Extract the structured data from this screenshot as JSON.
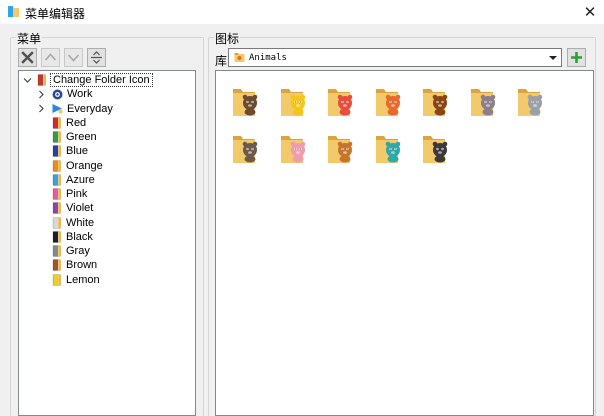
{
  "window": {
    "title": "菜单编辑器",
    "close_glyph": "✕"
  },
  "menu_group": {
    "label": "菜单",
    "toolbar": {
      "delete_icon": "delete-x-icon",
      "move_up_icon": "arrow-up-icon",
      "move_down_icon": "arrow-down-icon",
      "separator_icon": "separator-icon"
    }
  },
  "tree": {
    "root": {
      "label": "Change Folder Icon",
      "color": "#c0392b",
      "expanded": true
    },
    "items": [
      {
        "label": "Work",
        "icon": "work-icon",
        "color": "#2b4a9a",
        "has_children": true
      },
      {
        "label": "Everyday",
        "icon": "everyday-icon",
        "color": "#2e86de",
        "has_children": true
      },
      {
        "label": "Red",
        "icon": "flag-icon",
        "color": "#d62828",
        "has_children": false
      },
      {
        "label": "Green",
        "icon": "flag-icon",
        "color": "#2e9e4a",
        "has_children": false
      },
      {
        "label": "Blue",
        "icon": "flag-icon",
        "color": "#2a3ea8",
        "has_children": false
      },
      {
        "label": "Orange",
        "icon": "flag-icon",
        "color": "#f08a1c",
        "has_children": false
      },
      {
        "label": "Azure",
        "icon": "flag-icon",
        "color": "#2fa4e7",
        "has_children": false
      },
      {
        "label": "Pink",
        "icon": "flag-icon",
        "color": "#e85aa3",
        "has_children": false
      },
      {
        "label": "Violet",
        "icon": "flag-icon",
        "color": "#8e44ad",
        "has_children": false
      },
      {
        "label": "White",
        "icon": "flag-icon",
        "color": "#d8d8d8",
        "has_children": false
      },
      {
        "label": "Black",
        "icon": "flag-icon",
        "color": "#1e1e2e",
        "has_children": false
      },
      {
        "label": "Gray",
        "icon": "flag-icon",
        "color": "#7f8c8d",
        "has_children": false
      },
      {
        "label": "Brown",
        "icon": "flag-icon",
        "color": "#a0522d",
        "has_children": false
      },
      {
        "label": "Lemon",
        "icon": "flag-icon",
        "color": "#e6d21a",
        "has_children": false
      }
    ]
  },
  "icon_group": {
    "label": "图标",
    "library_label": "库",
    "library_value": "Animals",
    "add_icon": "plus-icon",
    "icons": [
      {
        "name": "cat",
        "color": "#6b4a2f"
      },
      {
        "name": "chick",
        "color": "#f5c518"
      },
      {
        "name": "crab",
        "color": "#e74c3c"
      },
      {
        "name": "fox",
        "color": "#e8692c"
      },
      {
        "name": "lion",
        "color": "#8b4513"
      },
      {
        "name": "hippo",
        "color": "#8a7f8a"
      },
      {
        "name": "koala",
        "color": "#9aa0a6"
      },
      {
        "name": "raccoon",
        "color": "#6d5a4b"
      },
      {
        "name": "pig",
        "color": "#f19bb0"
      },
      {
        "name": "dog",
        "color": "#c8742b"
      },
      {
        "name": "bird",
        "color": "#2ea8a8"
      },
      {
        "name": "zebra",
        "color": "#3a3a3a"
      }
    ]
  },
  "colors": {
    "folder": "#f2c96b",
    "folder_dark": "#d9a53f",
    "plus": "#2e9e3a"
  }
}
